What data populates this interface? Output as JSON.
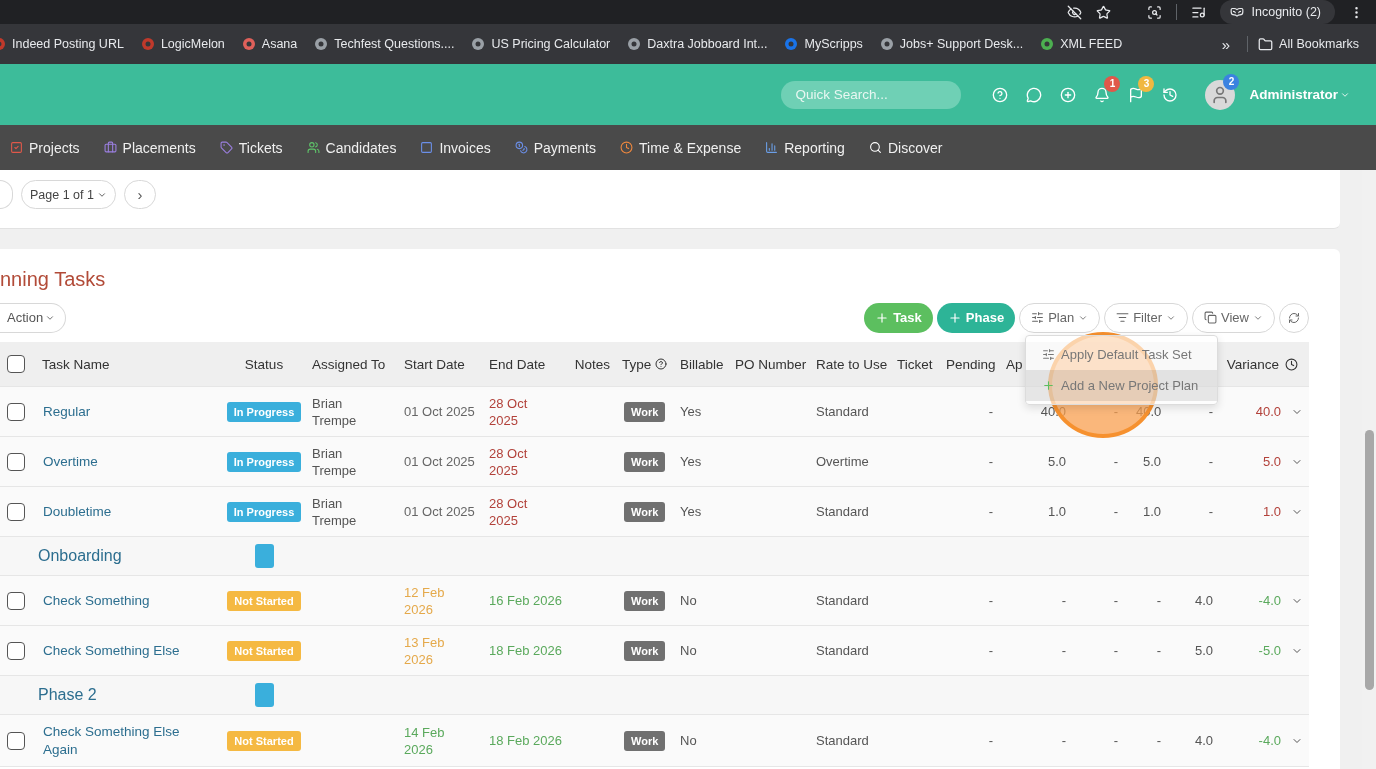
{
  "browser": {
    "profile": "Incognito (2)"
  },
  "bookmarks": {
    "items": [
      {
        "label": "Indeed Posting URL"
      },
      {
        "label": "LogicMelon"
      },
      {
        "label": "Asana"
      },
      {
        "label": "Techfest Questions...."
      },
      {
        "label": "US Pricing Calculator"
      },
      {
        "label": "Daxtra Jobboard Int..."
      },
      {
        "label": "MyScripps"
      },
      {
        "label": "Jobs+ Support Desk..."
      },
      {
        "label": "XML FEED"
      }
    ],
    "more": "»",
    "all": "All Bookmarks"
  },
  "header": {
    "search": {
      "placeholder": "Quick Search..."
    },
    "notifications": "1",
    "flags": "3",
    "messages": "2",
    "user": "Administrator"
  },
  "nav": [
    {
      "label": "Projects"
    },
    {
      "label": "Placements"
    },
    {
      "label": "Tickets"
    },
    {
      "label": "Candidates"
    },
    {
      "label": "Invoices"
    },
    {
      "label": "Payments"
    },
    {
      "label": "Time & Expense"
    },
    {
      "label": "Reporting"
    },
    {
      "label": "Discover"
    }
  ],
  "pager": {
    "label": "Page 1 of 1",
    "next": "›"
  },
  "tasks_panel": {
    "title": "nning Tasks",
    "action": "Action",
    "buttons": [
      {
        "kind": "task",
        "label": "Task"
      },
      {
        "kind": "phase",
        "label": "Phase"
      },
      {
        "kind": "plan",
        "label": "Plan"
      },
      {
        "kind": "filter",
        "label": "Filter"
      },
      {
        "kind": "view",
        "label": "View"
      }
    ],
    "menu": [
      {
        "label": "Apply Default Task Set",
        "kind": "sliders",
        "selected": false
      },
      {
        "label": "Add a New Project Plan",
        "kind": "plus",
        "selected": true
      }
    ],
    "columns": [
      "Task Name",
      "Status",
      "Assigned To",
      "Start Date",
      "End Date",
      "Notes",
      "Type",
      "Billable",
      "PO Number",
      "Rate to Use",
      "Ticket",
      "Pending",
      "Ap",
      "Variance"
    ],
    "header_checked": false,
    "rows": [
      {
        "kind": "task",
        "name": "Regular",
        "checked": false,
        "status": {
          "label": "In Progress",
          "color": "#3aafdc"
        },
        "assigned": "Brian Trempe",
        "start": {
          "text": "01 Oct 2025",
          "kind": "plain"
        },
        "end": {
          "text": "28 Oct 2025",
          "kind": "overdue"
        },
        "type": "Work",
        "billable": "Yes",
        "rate": "Standard",
        "values": [
          "-",
          "40.0",
          "-",
          "40.0",
          "-"
        ],
        "variance": {
          "text": "40.0",
          "color": "#b2413a"
        }
      },
      {
        "kind": "task",
        "name": "Overtime",
        "checked": false,
        "status": {
          "label": "In Progress",
          "color": "#3aafdc"
        },
        "assigned": "Brian Trempe",
        "start": {
          "text": "01 Oct 2025",
          "kind": "plain"
        },
        "end": {
          "text": "28 Oct 2025",
          "kind": "overdue"
        },
        "type": "Work",
        "billable": "Yes",
        "rate": "Overtime",
        "values": [
          "-",
          "5.0",
          "-",
          "5.0",
          "-"
        ],
        "variance": {
          "text": "5.0",
          "color": "#b2413a"
        }
      },
      {
        "kind": "task",
        "name": "Doubletime",
        "checked": false,
        "status": {
          "label": "In Progress",
          "color": "#3aafdc"
        },
        "assigned": "Brian Trempe",
        "start": {
          "text": "01 Oct 2025",
          "kind": "plain"
        },
        "end": {
          "text": "28 Oct 2025",
          "kind": "overdue"
        },
        "type": "Work",
        "billable": "Yes",
        "rate": "Standard",
        "values": [
          "-",
          "1.0",
          "-",
          "1.0",
          "-"
        ],
        "variance": {
          "text": "1.0",
          "color": "#b2413a"
        }
      },
      {
        "kind": "phase",
        "name": "Onboarding",
        "color": "#3aafdc"
      },
      {
        "kind": "task",
        "name": "Check Something",
        "checked": false,
        "status": {
          "label": "Not Started",
          "color": "#f5b942"
        },
        "start": {
          "text": "12 Feb 2026",
          "kind": "upcoming"
        },
        "end": {
          "text": "16 Feb 2026",
          "kind": "scheduled"
        },
        "type": "Work",
        "billable": "No",
        "rate": "Standard",
        "values": [
          "-",
          "-",
          "-",
          "-",
          "4.0"
        ],
        "variance": {
          "text": "-4.0",
          "color": "#5aa95c"
        }
      },
      {
        "kind": "task",
        "name": "Check Something Else",
        "checked": false,
        "status": {
          "label": "Not Started",
          "color": "#f5b942"
        },
        "start": {
          "text": "13 Feb 2026",
          "kind": "upcoming"
        },
        "end": {
          "text": "18 Feb 2026",
          "kind": "scheduled"
        },
        "type": "Work",
        "billable": "No",
        "rate": "Standard",
        "values": [
          "-",
          "-",
          "-",
          "-",
          "5.0"
        ],
        "variance": {
          "text": "-5.0",
          "color": "#5aa95c"
        }
      },
      {
        "kind": "phase",
        "name": "Phase 2",
        "color": "#3aafdc"
      },
      {
        "kind": "task",
        "name": "Check Something Else Again",
        "checked": false,
        "status": {
          "label": "Not Started",
          "color": "#f5b942"
        },
        "start": {
          "text": "14 Feb 2026",
          "kind": "started"
        },
        "end": {
          "text": "18 Feb 2026",
          "kind": "scheduled"
        },
        "type": "Work",
        "billable": "No",
        "rate": "Standard",
        "values": [
          "-",
          "-",
          "-",
          "-",
          "4.0"
        ],
        "variance": {
          "text": "-4.0",
          "color": "#5aa95c"
        }
      }
    ]
  }
}
